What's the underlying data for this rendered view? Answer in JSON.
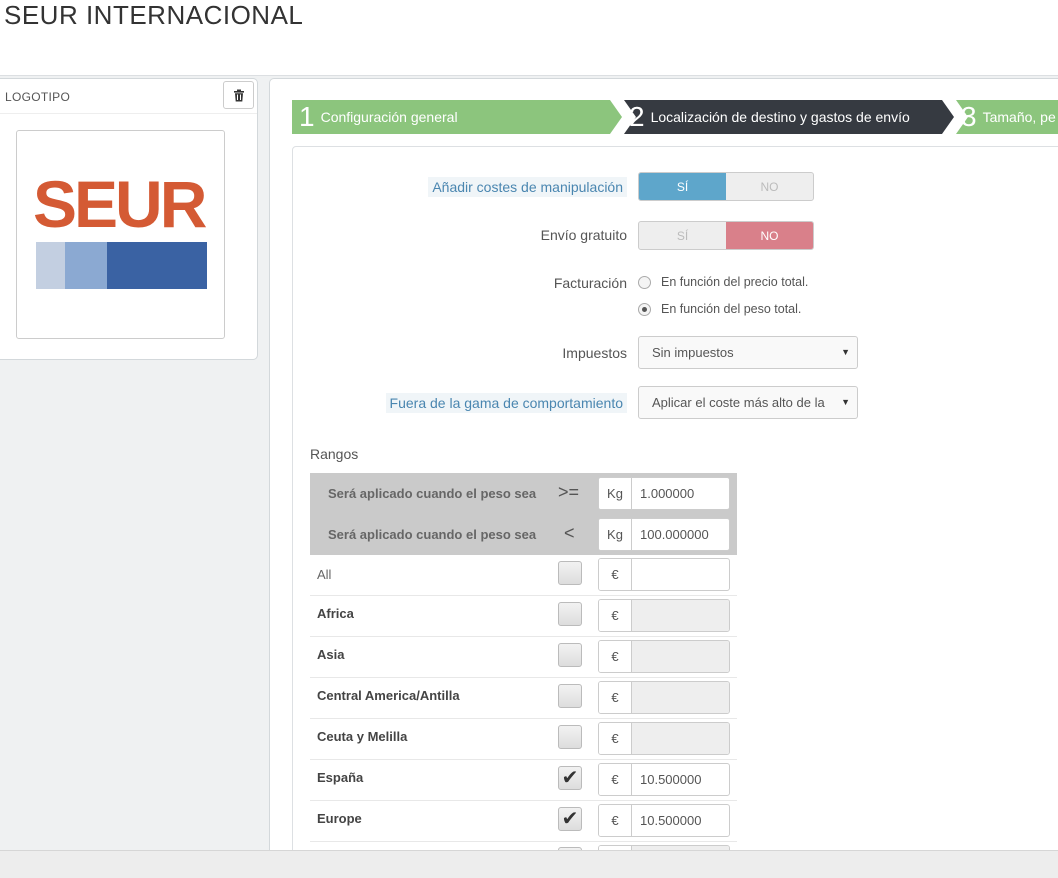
{
  "page": {
    "title": "SEUR INTERNACIONAL"
  },
  "logo_panel": {
    "title": "LOGOTIPO",
    "delete_icon": "trash-icon",
    "brand_text": "SEUR",
    "bar_colors": [
      "#c3cfe1",
      "#8ba9d2",
      "#3a62a3"
    ],
    "brand_color": "#d45a34"
  },
  "wizard": {
    "steps": [
      {
        "num": "1",
        "label": "Configuración general",
        "state": "done",
        "color": "#8cc57d"
      },
      {
        "num": "2",
        "label": "Localización de destino y gastos de envío",
        "state": "active",
        "color": "#363a41"
      },
      {
        "num": "3",
        "label": "Tamaño, pe",
        "state": "todo",
        "color": "#8cc57d"
      }
    ]
  },
  "form": {
    "handling": {
      "label": "Añadir costes de manipulación",
      "yes": "SÍ",
      "no": "NO",
      "value": "yes"
    },
    "free_shipping": {
      "label": "Envío gratuito",
      "yes": "SÍ",
      "no": "NO",
      "value": "no"
    },
    "billing": {
      "label": "Facturación",
      "options": [
        "En función del precio total.",
        "En función del peso total."
      ],
      "selected": 1
    },
    "tax": {
      "label": "Impuestos",
      "value": "Sin impuestos"
    },
    "out_of_range": {
      "label": "Fuera de la gama de comportamiento",
      "value": "Aplicar el coste más alto de la"
    }
  },
  "ranges": {
    "title": "Rangos",
    "rows": [
      {
        "text": "Será aplicado cuando el peso sea",
        "op": ">=",
        "unit": "Kg",
        "value": "1.000000"
      },
      {
        "text": "Será aplicado cuando el peso sea",
        "op": "<",
        "unit": "Kg",
        "value": "100.000000"
      }
    ],
    "currency": "€",
    "zones": [
      {
        "name": "All",
        "checked": false,
        "price": "",
        "light": true
      },
      {
        "name": "Africa",
        "checked": false,
        "price": ""
      },
      {
        "name": "Asia",
        "checked": false,
        "price": ""
      },
      {
        "name": "Central America/Antilla",
        "checked": false,
        "price": ""
      },
      {
        "name": "Ceuta y Melilla",
        "checked": false,
        "price": ""
      },
      {
        "name": "España",
        "checked": true,
        "price": "10.500000"
      },
      {
        "name": "Europe",
        "checked": true,
        "price": "10.500000"
      }
    ]
  }
}
